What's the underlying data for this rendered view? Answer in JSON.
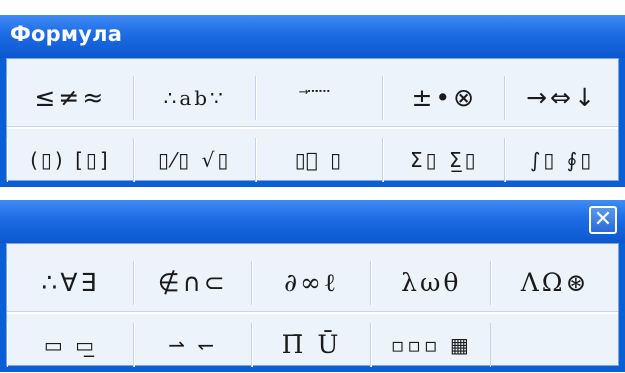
{
  "top_window": {
    "title": "Формула",
    "row1": [
      {
        "label": "≤≠≈"
      },
      {
        "label": "∴ab∵"
      },
      {
        "label": "⃗ ⃛ ⃜"
      },
      {
        "label": "±•⊗"
      },
      {
        "label": "→⇔↓"
      }
    ],
    "row2": [
      {
        "label": "(▯) [▯]"
      },
      {
        "label": "▯⁄▯ √▯"
      },
      {
        "label": "▯⃞ ▯"
      },
      {
        "label": "Σ▯ Σ̲▯"
      },
      {
        "label": "∫▯ ∮▯"
      }
    ]
  },
  "bottom_window": {
    "close_label": "✕",
    "row1": [
      {
        "label": "∴∀∃"
      },
      {
        "label": "∉∩⊂"
      },
      {
        "label": "∂∞ℓ"
      },
      {
        "label": "λωθ"
      },
      {
        "label": "ΛΩ⊛"
      }
    ],
    "row2": [
      {
        "label": "▭ ▭̲"
      },
      {
        "label": "⇀ ↽"
      },
      {
        "label": "Π̄ Ū"
      },
      {
        "label": "▫▫▫ ▦"
      }
    ]
  }
}
